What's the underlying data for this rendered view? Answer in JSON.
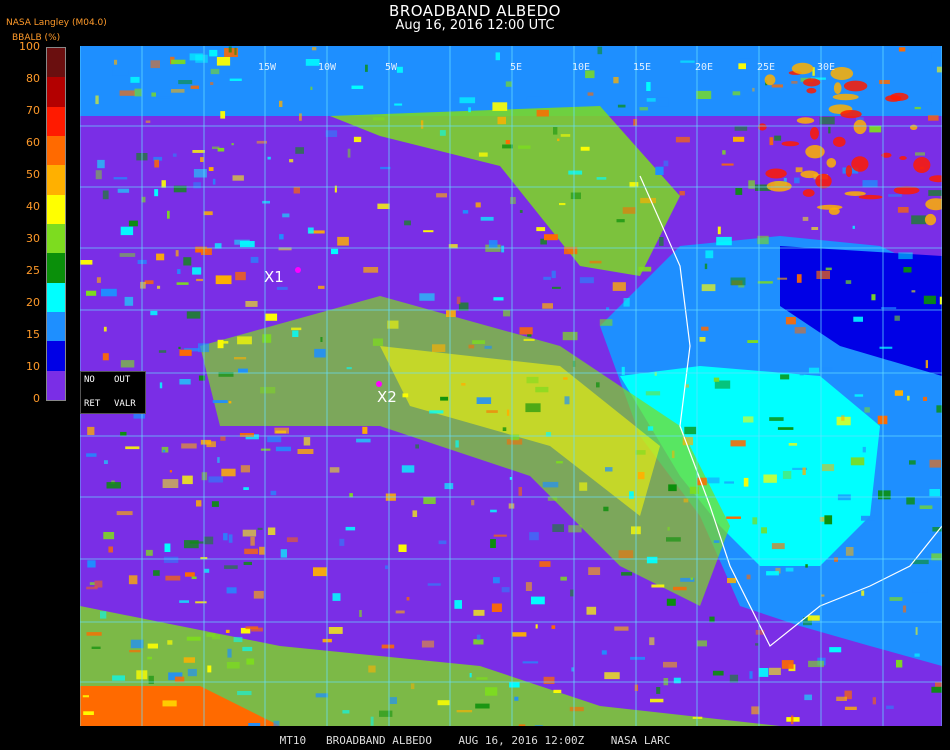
{
  "header": {
    "title": "BROADBAND ALBEDO",
    "subtitle": "Aug 16, 2016 12:00 UTC"
  },
  "legend": {
    "source": "NASA Langley (M04.0)",
    "unit_label": "BBALB (%)",
    "ticks": [
      "100",
      "80",
      "70",
      "60",
      "50",
      "40",
      "30",
      "25",
      "20",
      "15",
      "10",
      "0"
    ],
    "colors": [
      "#6a0f0f",
      "#b30000",
      "#ff1a00",
      "#ff6a00",
      "#ffb000",
      "#ffff00",
      "#7ddc1f",
      "#0a8f0a",
      "#00ffff",
      "#1e8fff",
      "#0000e6",
      "#7a2ee6"
    ]
  },
  "nodata_box": {
    "no": "NO",
    "out": "OUT",
    "ret": "RET",
    "valr": "VALR"
  },
  "markers": {
    "x1": "X1",
    "x2": "X2"
  },
  "longitude_labels": [
    "15W",
    "10W",
    "5W",
    "5E",
    "10E",
    "15E",
    "20E",
    "25E",
    "30E"
  ],
  "footer": "MT10   BROADBAND ALBEDO    AUG 16, 2016 12:00Z    NASA LARC",
  "colors": {
    "ocean_clear": "#7a2ee6",
    "grid": "#66e0ff",
    "land_outline": "#ffffff"
  }
}
